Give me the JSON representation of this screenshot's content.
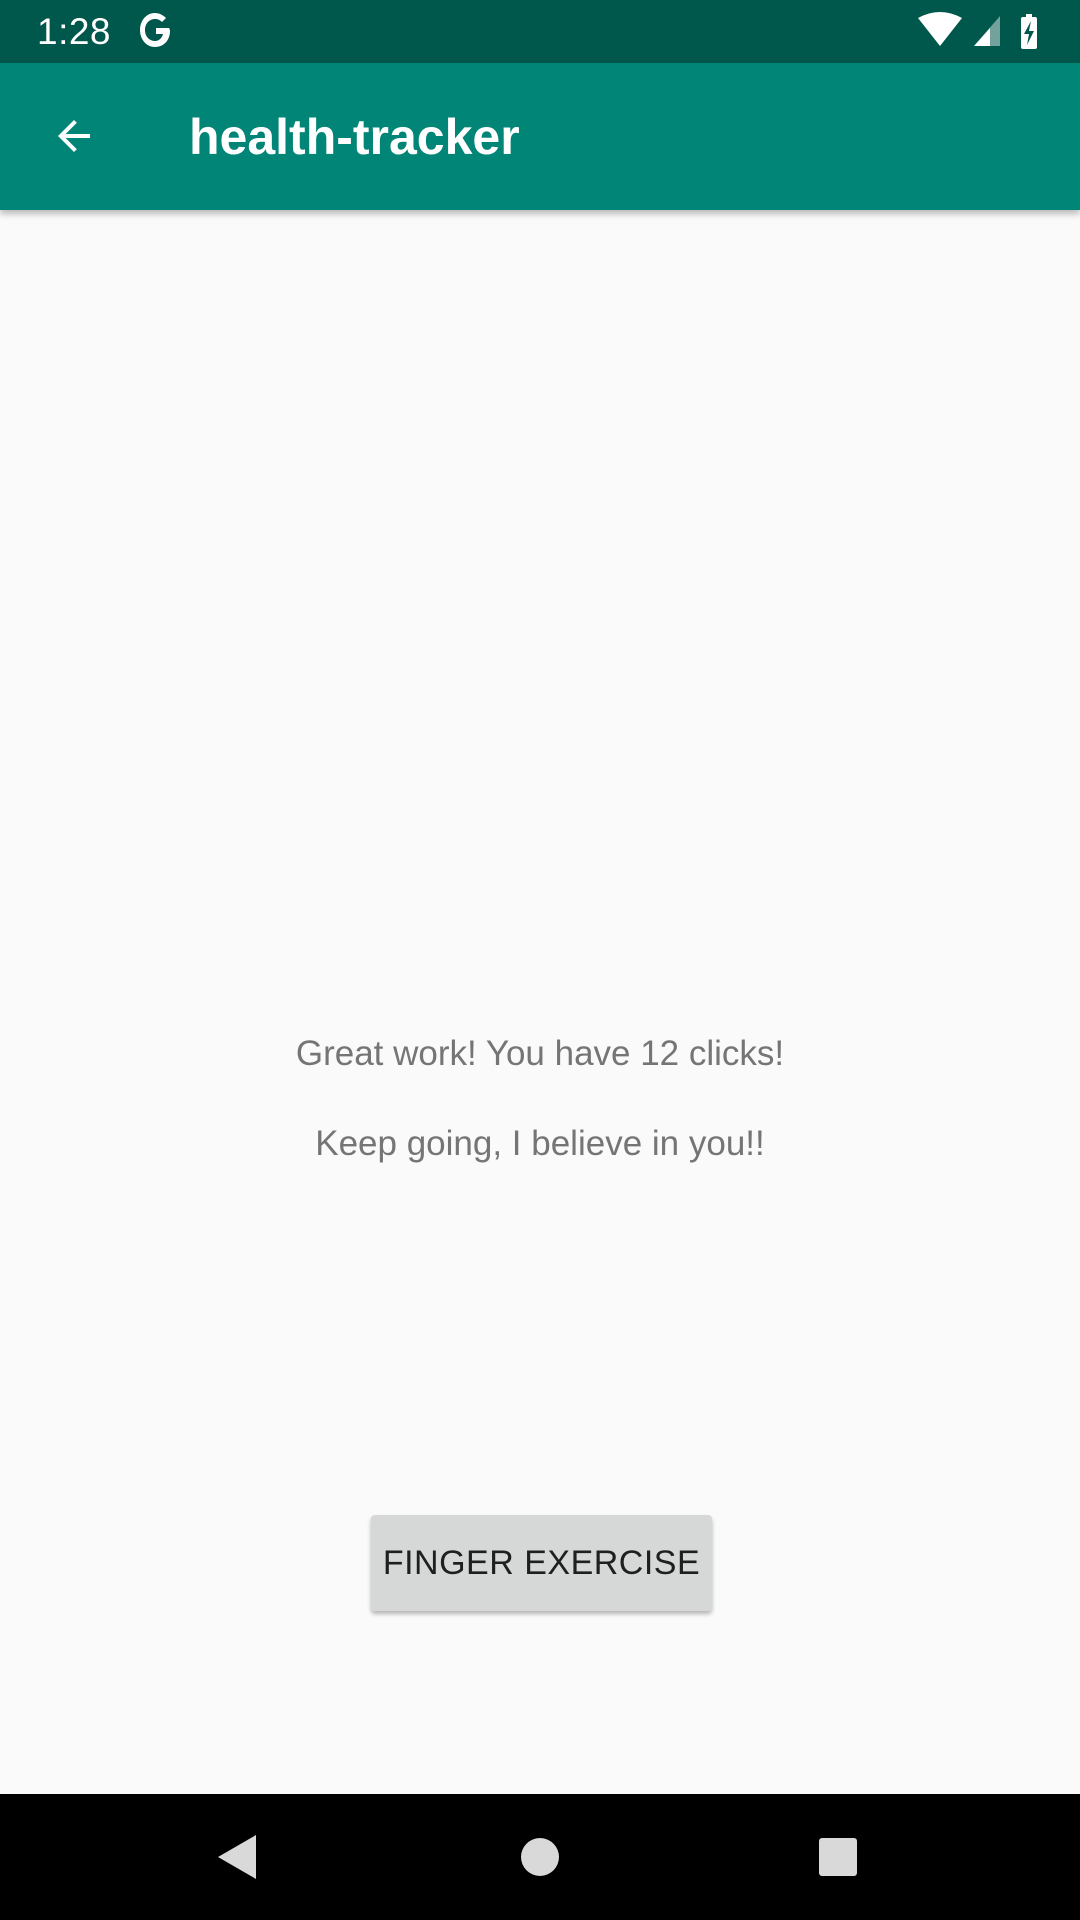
{
  "status_bar": {
    "time": "1:28",
    "notification_icon": "google-g-icon",
    "icons": [
      "wifi-icon",
      "cellular-signal-icon",
      "battery-charging-icon"
    ]
  },
  "app_bar": {
    "title": "health-tracker",
    "back_icon": "arrow-back-icon"
  },
  "main": {
    "message_line_1": "Great work! You have 12 clicks!",
    "message_line_2": "Keep going, I believe in you!!",
    "exercise_button_label": "FINGER EXERCISE"
  },
  "nav_bar": {
    "buttons": [
      "back-triangle-icon",
      "home-circle-icon",
      "recents-square-icon"
    ]
  },
  "colors": {
    "status_bar": "#00574b",
    "app_bar": "#008577",
    "background": "#fafafa",
    "button": "#d6d7d7",
    "message_text": "#757575"
  }
}
